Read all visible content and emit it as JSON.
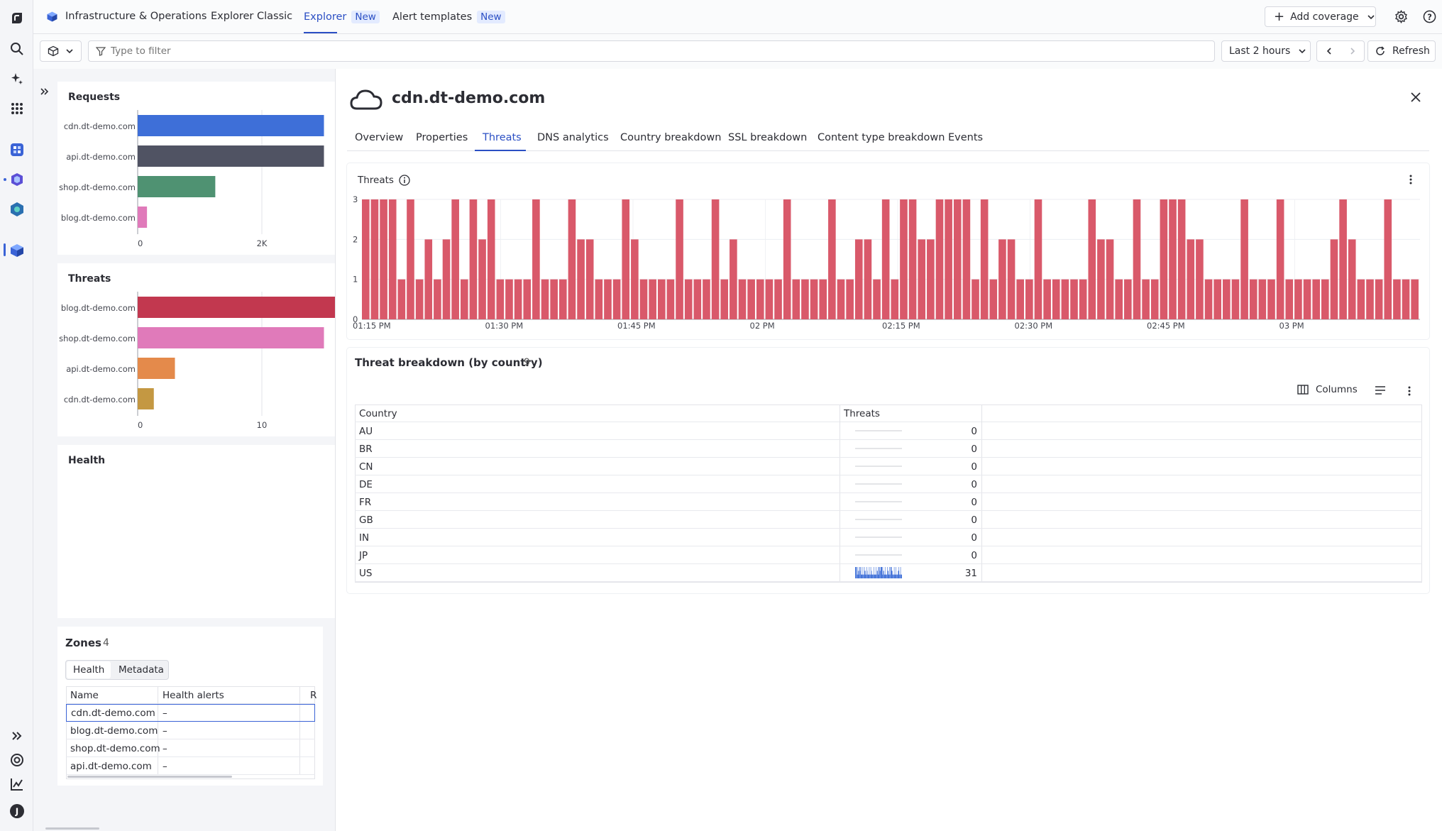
{
  "topnav": {
    "app_title": "Infrastructure & Operations",
    "explorer_classic": "Explorer Classic",
    "explorer": "Explorer",
    "explorer_badge": "New",
    "alert_templates": "Alert templates",
    "alert_badge": "New",
    "add_coverage": "Add coverage"
  },
  "filterbar": {
    "placeholder": "Type to filter",
    "timeframe": "Last 2 hours",
    "refresh": "Refresh"
  },
  "requests_panel": {
    "title": "Requests",
    "chart_data": {
      "type": "bar",
      "orientation": "horizontal",
      "categories": [
        "cdn.dt-demo.com",
        "api.dt-demo.com",
        "shop.dt-demo.com",
        "blog.dt-demo.com"
      ],
      "values": [
        3000,
        3000,
        1250,
        150
      ],
      "x_ticks": [
        "0",
        "2K"
      ],
      "colors": [
        "#3e6fd8",
        "#505363",
        "#4f9272",
        "#e07aba"
      ]
    }
  },
  "threats_panel": {
    "title": "Threats",
    "chart_data": {
      "type": "bar",
      "orientation": "horizontal",
      "categories": [
        "blog.dt-demo.com",
        "shop.dt-demo.com",
        "api.dt-demo.com",
        "cdn.dt-demo.com"
      ],
      "values": [
        20,
        15,
        3,
        1.3
      ],
      "x_ticks": [
        "0",
        "10"
      ],
      "colors": [
        "#c2384f",
        "#e07aba",
        "#e48a4b",
        "#c49842"
      ]
    }
  },
  "health_panel": {
    "title": "Health"
  },
  "zones": {
    "title": "Zones",
    "count": "4",
    "tabs": [
      "Health",
      "Metadata"
    ],
    "columns": [
      "Name",
      "Health alerts",
      "R"
    ],
    "rows": [
      {
        "name": "cdn.dt-demo.com",
        "alerts": "–"
      },
      {
        "name": "blog.dt-demo.com",
        "alerts": "–"
      },
      {
        "name": "shop.dt-demo.com",
        "alerts": "–"
      },
      {
        "name": "api.dt-demo.com",
        "alerts": "–"
      }
    ]
  },
  "detail": {
    "title": "cdn.dt-demo.com",
    "tabs": [
      "Overview",
      "Properties",
      "Threats",
      "DNS analytics",
      "Country breakdown",
      "SSL breakdown",
      "Content type breakdown",
      "Events"
    ],
    "active_tab": "Threats"
  },
  "threats_chart": {
    "title": "Threats",
    "chart_data": {
      "type": "bar",
      "y_ticks": [
        "0",
        "1",
        "2",
        "3"
      ],
      "ylim": [
        0,
        3
      ],
      "x_ticks": [
        "01:15 PM",
        "01:30 PM",
        "01:45 PM",
        "02 PM",
        "02:15 PM",
        "02:30 PM",
        "02:45 PM",
        "03 PM"
      ],
      "color": "#d9596a",
      "values": [
        3,
        3,
        3,
        3,
        1,
        3,
        1,
        2,
        1,
        2,
        3,
        1,
        3,
        2,
        3,
        1,
        1,
        1,
        1,
        3,
        1,
        1,
        1,
        3,
        2,
        2,
        1,
        1,
        1,
        3,
        2,
        1,
        1,
        1,
        1,
        3,
        1,
        1,
        1,
        3,
        1,
        2,
        1,
        1,
        1,
        1,
        1,
        3,
        1,
        1,
        1,
        1,
        3,
        1,
        1,
        2,
        2,
        1,
        3,
        1,
        3,
        3,
        2,
        2,
        3,
        3,
        3,
        3,
        1,
        3,
        1,
        2,
        2,
        1,
        1,
        3,
        1,
        1,
        1,
        1,
        1,
        3,
        2,
        2,
        1,
        1,
        3,
        1,
        1,
        3,
        3,
        3,
        2,
        2,
        1,
        1,
        1,
        1,
        3,
        1,
        1,
        1,
        3,
        1,
        1,
        1,
        1,
        1,
        2,
        3,
        2,
        1,
        1,
        1,
        3,
        1,
        1,
        1
      ]
    }
  },
  "breakdown": {
    "title": "Threat breakdown (by country)",
    "count": "9",
    "columns_button": "Columns",
    "headers": [
      "Country",
      "Threats"
    ],
    "rows": [
      {
        "country": "AU",
        "threats": "0"
      },
      {
        "country": "BR",
        "threats": "0"
      },
      {
        "country": "CN",
        "threats": "0"
      },
      {
        "country": "DE",
        "threats": "0"
      },
      {
        "country": "FR",
        "threats": "0"
      },
      {
        "country": "GB",
        "threats": "0"
      },
      {
        "country": "IN",
        "threats": "0"
      },
      {
        "country": "JP",
        "threats": "0"
      },
      {
        "country": "US",
        "threats": "31"
      }
    ]
  }
}
